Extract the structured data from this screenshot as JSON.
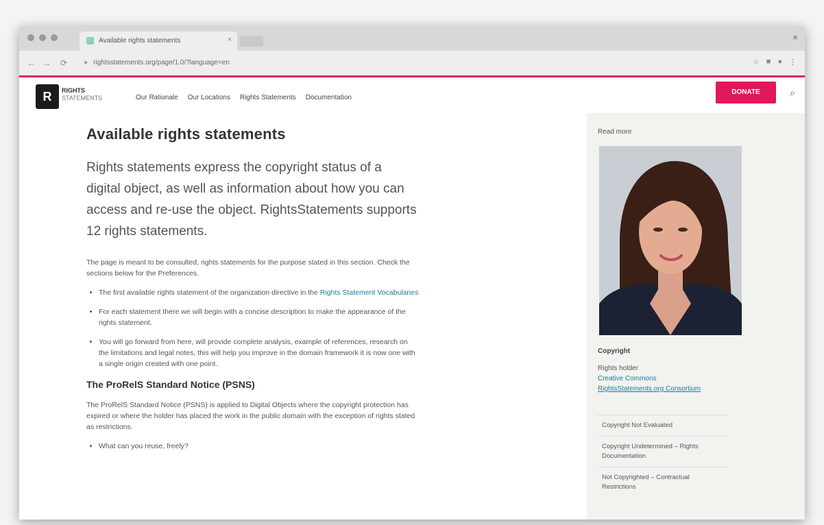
{
  "browser": {
    "tab_title": "Available rights statements",
    "url": "rightsstatements.org/page/1.0/?language=en",
    "nav_back": "←",
    "nav_forward": "→",
    "nav_reload": "⟳",
    "close": "×"
  },
  "site": {
    "logo_letter": "R",
    "brand_line1": "RIGHTS",
    "brand_line2": "STATEMENTS",
    "nav": [
      "Our Rationale",
      "Our Locations",
      "Rights Statements",
      "Documentation"
    ],
    "donate_label": "DONATE"
  },
  "main": {
    "title": "Available rights statements",
    "lead": "Rights statements express the copyright status of a digital object, as well as information about how you can access and re-use the object. RightsStatements supports 12 rights statements.",
    "intro": "The page is meant to be consulted, rights statements for the purpose stated in this section. Check the sections below for the Preferences.",
    "bullets": [
      {
        "text": "The first available rights statement of the organization directive in the ",
        "link": "Rights Statement Vocabularies"
      },
      {
        "text": "For each statement there we will begin with a concise description to make the appearance of the rights statement.",
        "link": ""
      },
      {
        "text": "You will go forward from here, will provide complete analysis, example of references, research on the limitations and legal notes, this will help you improve in the domain framework it is now one with a single origin created with one point.",
        "link": ""
      }
    ],
    "section_heading": "The ProRelS Standard Notice (PSNS)",
    "section_para": "The ProRelS Standard Notice (PSNS) is applied to Digital Objects where the copyright protection has expired or where the holder has placed the work in the public domain with the exception of rights stated as restrictions.",
    "section_bullet": "What can you reuse, freely?"
  },
  "sidebar": {
    "title": "Read more",
    "caption_title": "Copyright",
    "caption_line1": "Rights holder",
    "caption_link1": "Creative Commons",
    "caption_link2": "RightsStatements.org Consortium",
    "links": [
      "Copyright Not Evaluated",
      "Copyright Undetermined – Rights Documentation",
      "Not Copyrighted – Contractual Restrictions"
    ]
  }
}
